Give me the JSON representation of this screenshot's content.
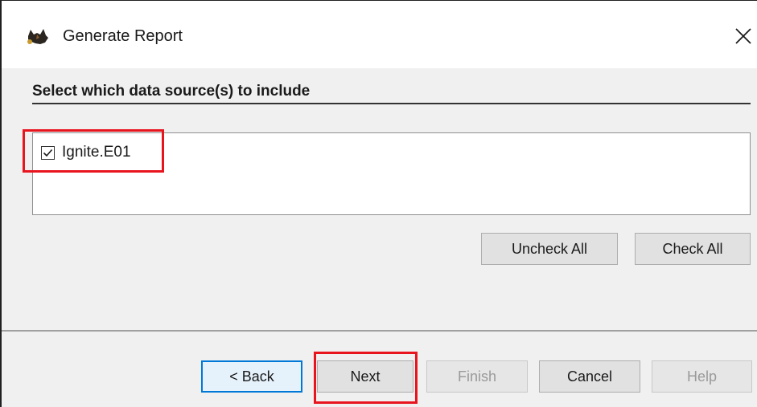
{
  "window": {
    "title": "Generate Report",
    "app_icon": "autopsy-dog-icon",
    "close_icon": "close-icon"
  },
  "section": {
    "heading": "Select which data source(s) to include"
  },
  "data_sources": [
    {
      "label": "Ignite.E01",
      "checked": true
    }
  ],
  "list_buttons": {
    "uncheck_all": "Uncheck All",
    "check_all": "Check All"
  },
  "nav_buttons": {
    "back": "< Back",
    "next": "Next",
    "finish": "Finish",
    "cancel": "Cancel",
    "help": "Help"
  },
  "colors": {
    "highlight": "#e8141e",
    "focus": "#0078d7"
  }
}
